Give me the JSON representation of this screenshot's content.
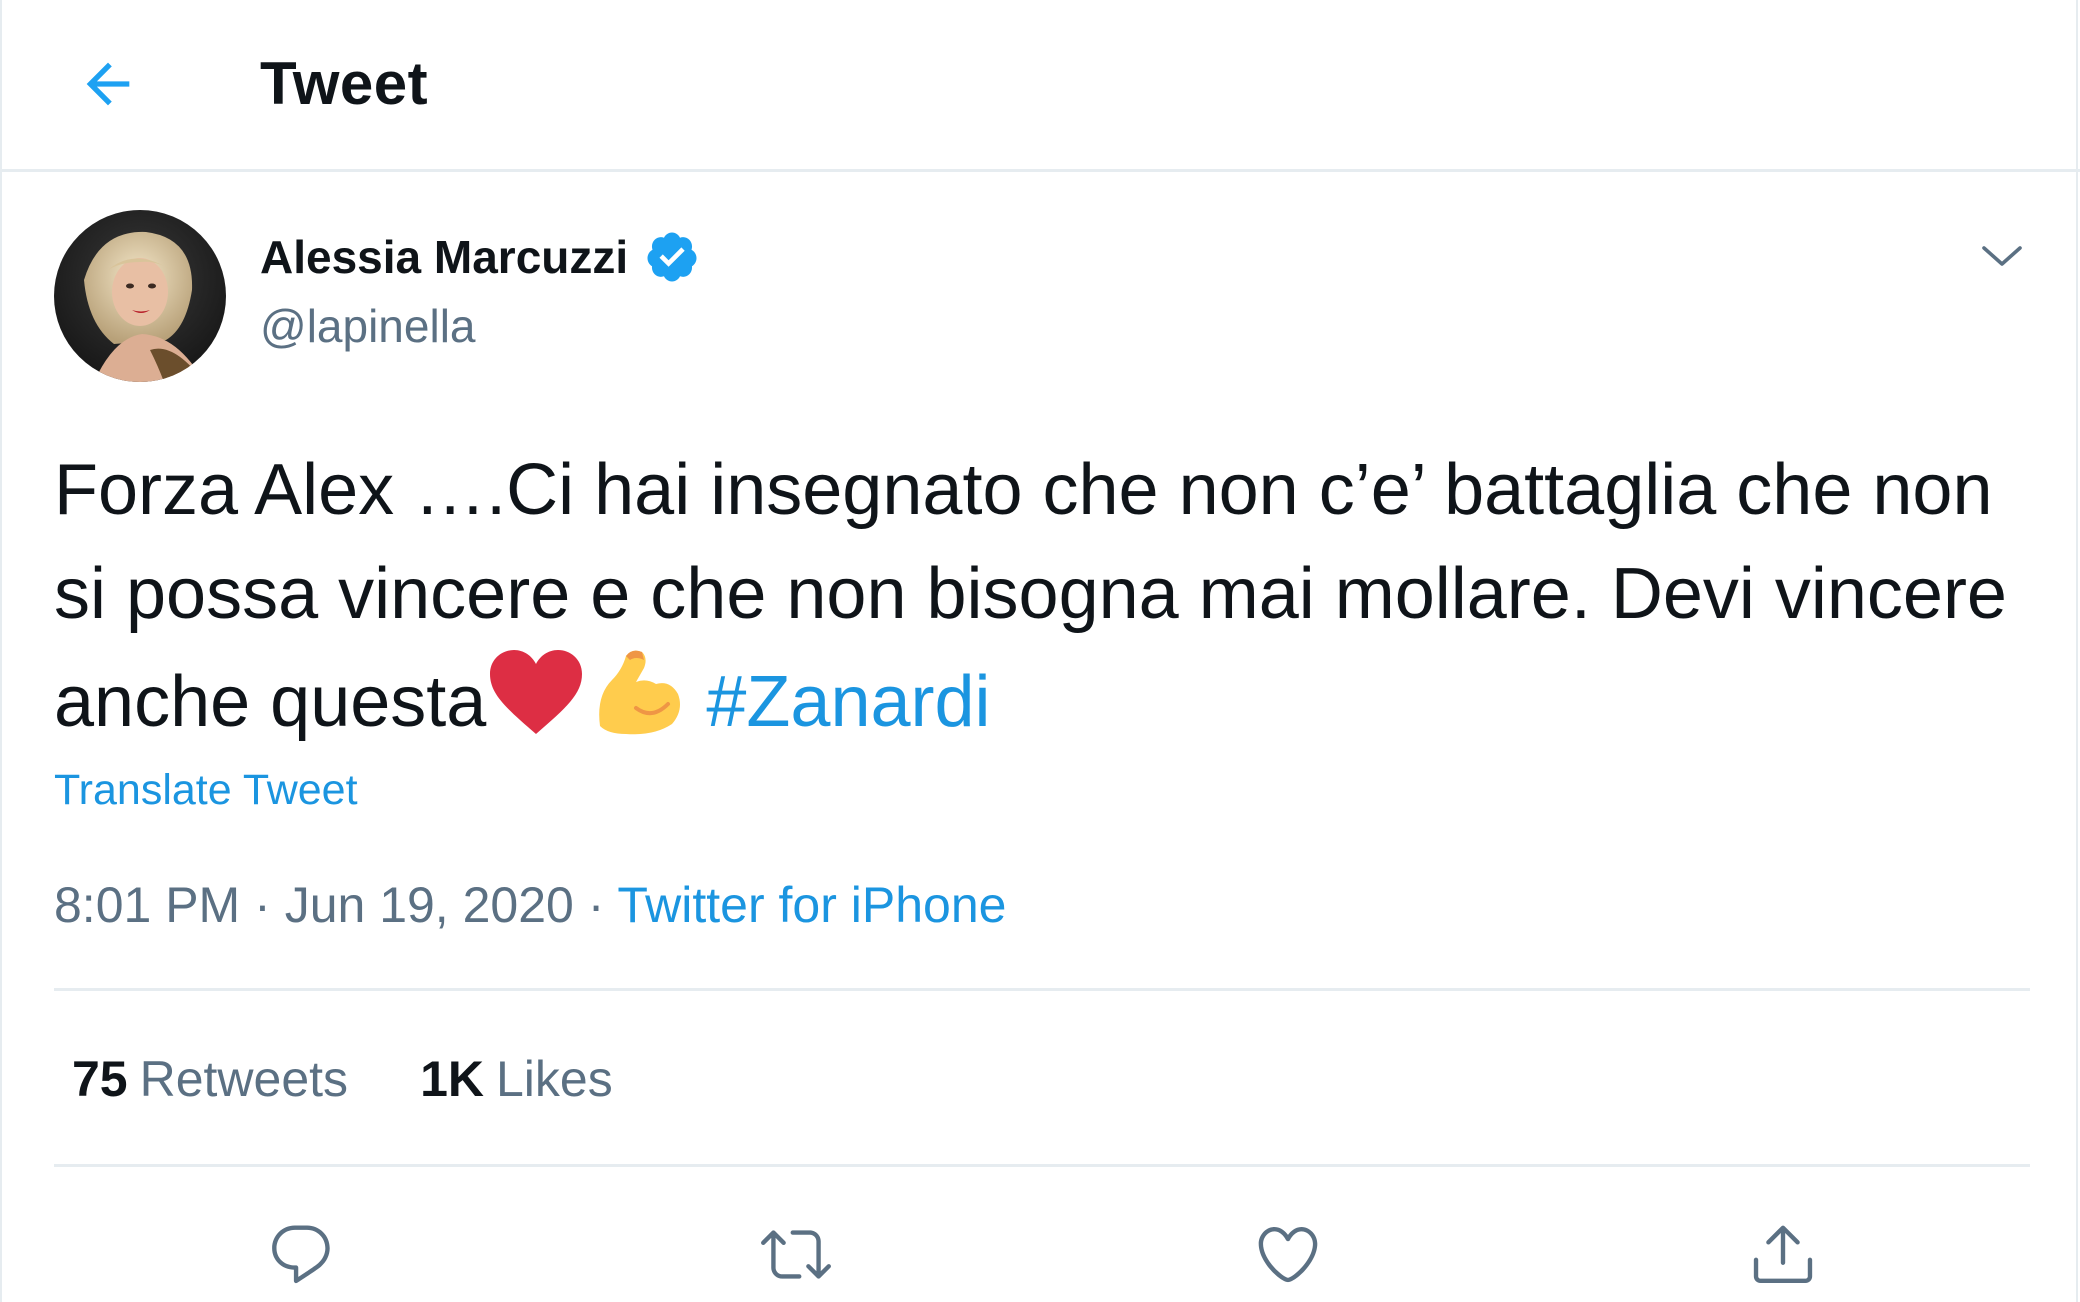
{
  "header": {
    "title": "Tweet",
    "back_icon": "arrow-left-icon"
  },
  "author": {
    "display_name": "Alessia Marcuzzi",
    "handle": "@lapinella",
    "verified_icon": "verified-badge-icon"
  },
  "tweet": {
    "text_before_emoji": "Forza Alex ….Ci hai insegnato che non c’e’ battaglia che non si possa vincere e che non bisogna mai mollare. Devi vincere anche questa",
    "emojis": [
      "red-heart-emoji",
      "flexed-biceps-emoji"
    ],
    "hashtag": "#Zanardi",
    "translate_label": "Translate Tweet",
    "time": "8:01 PM",
    "date": "Jun 19, 2020",
    "source": "Twitter for iPhone",
    "separator": "·"
  },
  "stats": {
    "retweets_count": "75",
    "retweets_label": "Retweets",
    "likes_count": "1K",
    "likes_label": "Likes"
  },
  "actions": [
    "reply-icon",
    "retweet-icon",
    "like-icon",
    "share-icon"
  ],
  "colors": {
    "accent": "#1da1f2",
    "link": "#1b95e0",
    "secondary_text": "#5b7083",
    "border": "#e6ecf0",
    "heart": "#dd2e44",
    "biceps": "#ffcc4d"
  }
}
